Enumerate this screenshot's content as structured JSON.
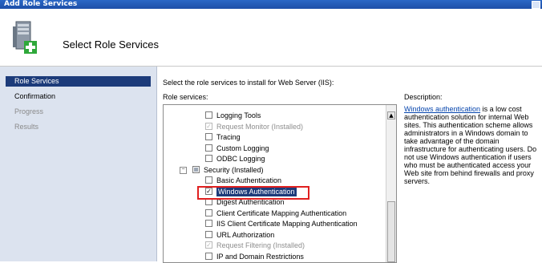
{
  "window": {
    "title": "Add Role Services"
  },
  "header": {
    "page_title": "Select Role Services",
    "icon": "server-add-icon"
  },
  "sidebar": {
    "items": [
      {
        "label": "Role Services",
        "state": "active"
      },
      {
        "label": "Confirmation",
        "state": "done"
      },
      {
        "label": "Progress",
        "state": "pending"
      },
      {
        "label": "Results",
        "state": "pending"
      }
    ]
  },
  "main": {
    "intro": "Select the role services to install for Web Server (IIS):",
    "role_services_label": "Role services:",
    "tree": [
      {
        "label": "Logging Tools",
        "checked": false,
        "disabled": false,
        "indent": 3
      },
      {
        "label": "Request Monitor  (Installed)",
        "checked": true,
        "disabled": true,
        "indent": 3
      },
      {
        "label": "Tracing",
        "checked": false,
        "disabled": false,
        "indent": 3
      },
      {
        "label": "Custom Logging",
        "checked": false,
        "disabled": false,
        "indent": 3
      },
      {
        "label": "ODBC Logging",
        "checked": false,
        "disabled": false,
        "indent": 3
      },
      {
        "label": "Security  (Installed)",
        "checked": false,
        "partial": true,
        "disabled": false,
        "indent": 2,
        "expander": "−"
      },
      {
        "label": "Basic Authentication",
        "checked": false,
        "disabled": false,
        "indent": 3
      },
      {
        "label": "Windows Authentication",
        "checked": true,
        "disabled": false,
        "indent": 3,
        "selected": true
      },
      {
        "label": "Digest Authentication",
        "checked": false,
        "disabled": false,
        "indent": 3
      },
      {
        "label": "Client Certificate Mapping Authentication",
        "checked": false,
        "disabled": false,
        "indent": 3
      },
      {
        "label": "IIS Client Certificate Mapping Authentication",
        "checked": false,
        "disabled": false,
        "indent": 3
      },
      {
        "label": "URL Authorization",
        "checked": false,
        "disabled": false,
        "indent": 3
      },
      {
        "label": "Request Filtering  (Installed)",
        "checked": true,
        "disabled": true,
        "indent": 3
      },
      {
        "label": "IP and Domain Restrictions",
        "checked": false,
        "disabled": false,
        "indent": 3
      }
    ]
  },
  "description": {
    "label": "Description:",
    "link": "Windows authentication",
    "text": " is a low cost authentication solution for internal Web sites. This authentication scheme allows administrators in a Windows domain to take advantage of the domain infrastructure for authenticating users. Do not use Windows authentication if users who must be authenticated access your Web site from behind firewalls and proxy servers."
  }
}
